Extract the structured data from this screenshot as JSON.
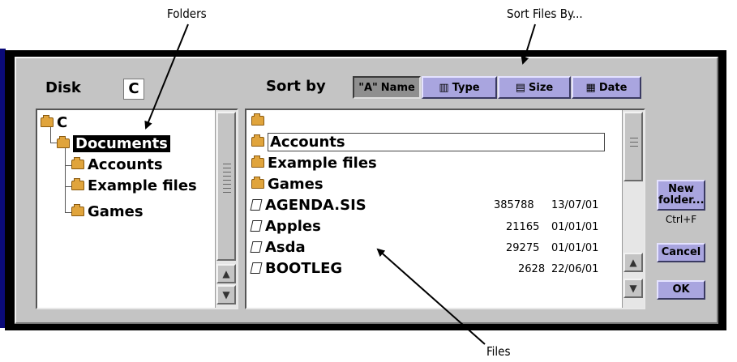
{
  "callouts": {
    "folders": "Folders",
    "sort_files_by": "Sort Files By...",
    "files": "Files"
  },
  "dialog": {
    "disk_label": "Disk",
    "disk_value": "C",
    "sort_label": "Sort by",
    "sort_buttons": [
      {
        "label": "Name",
        "icon": "\"A\"",
        "active": true
      },
      {
        "label": "Type",
        "icon": "▥",
        "active": false
      },
      {
        "label": "Size",
        "icon": "▤",
        "active": false
      },
      {
        "label": "Date",
        "icon": "▦",
        "active": false
      }
    ],
    "folder_tree": [
      {
        "label": "C",
        "level": 0
      },
      {
        "label": "Documents",
        "level": 1,
        "selected": true
      },
      {
        "label": "Accounts",
        "level": 2
      },
      {
        "label": "Example files",
        "level": 2
      },
      {
        "label": "Games",
        "level": 2
      }
    ],
    "file_list": [
      {
        "name": "",
        "type": "parent-folder"
      },
      {
        "name": "Accounts",
        "type": "folder",
        "focused": true
      },
      {
        "name": "Example files",
        "type": "folder"
      },
      {
        "name": "Games",
        "type": "folder"
      },
      {
        "name": "AGENDA.SIS",
        "type": "file",
        "size": "385788",
        "date": "13/07/01"
      },
      {
        "name": "Apples",
        "type": "file",
        "size": "21165",
        "date": "01/01/01"
      },
      {
        "name": "Asda",
        "type": "file",
        "size": "29275",
        "date": "01/01/01"
      },
      {
        "name": "BOOTLEG",
        "type": "file",
        "size": "2628",
        "date": "22/06/01"
      }
    ],
    "buttons": {
      "new_folder": "New folder...",
      "new_folder_shortcut": "Ctrl+F",
      "cancel": "Cancel",
      "ok": "OK"
    }
  },
  "colors": {
    "button_accent": "#a9a5df",
    "dialog_bg": "#c4c4c4",
    "folder": "#e0a43c"
  }
}
